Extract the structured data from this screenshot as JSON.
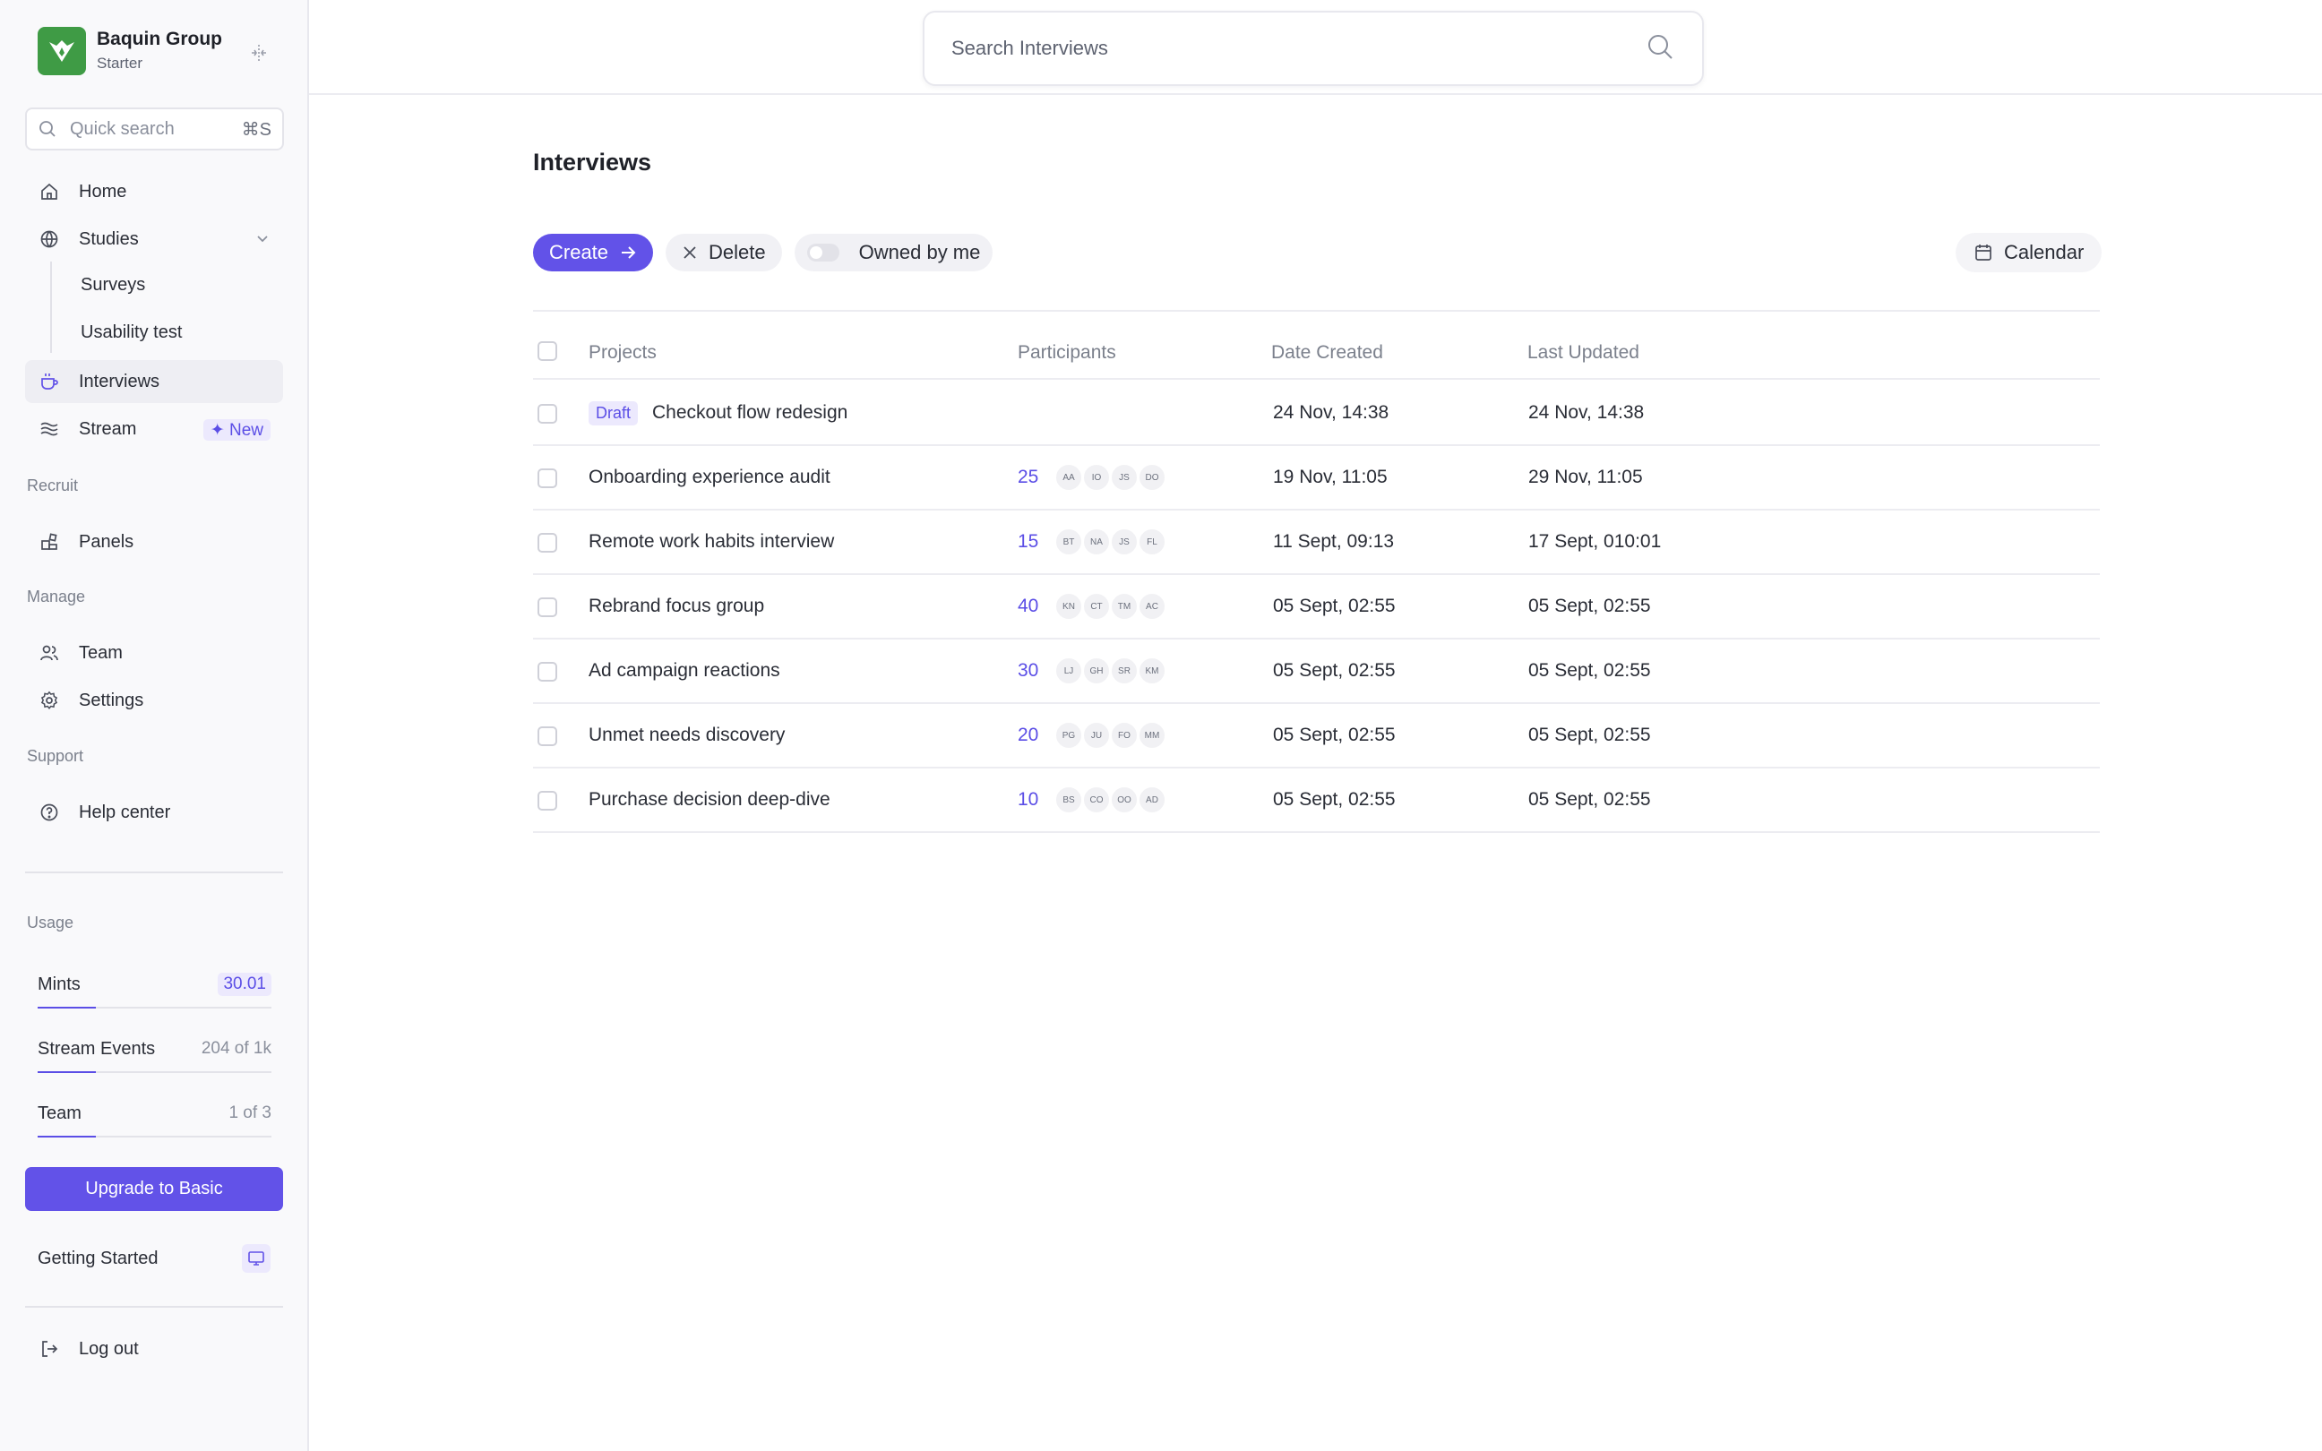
{
  "workspace": {
    "name": "Baquin Group",
    "plan": "Starter",
    "logo_color": "#3f9b45"
  },
  "quick_search": {
    "placeholder": "Quick search",
    "shortcut": "⌘S"
  },
  "nav": {
    "home": "Home",
    "studies": "Studies",
    "surveys": "Surveys",
    "usability_test": "Usability test",
    "interviews": "Interviews",
    "stream": "Stream",
    "stream_badge": "✦ New",
    "recruit_section": "Recruit",
    "panels": "Panels",
    "manage_section": "Manage",
    "team": "Team",
    "settings": "Settings",
    "support_section": "Support",
    "help_center": "Help center"
  },
  "usage": {
    "title": "Usage",
    "items": [
      {
        "label": "Mints",
        "value": "30.01",
        "progress": 0.25
      },
      {
        "label": "Stream Events",
        "value": "204 of 1k",
        "progress": 0.25
      },
      {
        "label": "Team",
        "value": "1 of 3",
        "progress": 0.25
      }
    ]
  },
  "upgrade_label": "Upgrade to Basic",
  "getting_started": "Getting Started",
  "logout": "Log out",
  "search": {
    "placeholder": "Search Interviews"
  },
  "page": {
    "title": "Interviews"
  },
  "toolbar": {
    "create": "Create",
    "delete": "Delete",
    "owned_by_me": "Owned by me",
    "calendar": "Calendar"
  },
  "table": {
    "columns": [
      "Projects",
      "Participants",
      "Date Created",
      "Last Updated"
    ],
    "rows": [
      {
        "badge": "Draft",
        "project": "Checkout flow redesign",
        "count": "",
        "avatars": [],
        "created": "24 Nov, 14:38",
        "updated": "24 Nov, 14:38"
      },
      {
        "badge": "",
        "project": "Onboarding experience audit",
        "count": "25",
        "avatars": [
          "AA",
          "IO",
          "JS",
          "DO"
        ],
        "created": "19 Nov, 11:05",
        "updated": "29 Nov, 11:05"
      },
      {
        "badge": "",
        "project": "Remote work habits interview",
        "count": "15",
        "avatars": [
          "BT",
          "NA",
          "JS",
          "FL"
        ],
        "created": "11 Sept, 09:13",
        "updated": "17 Sept, 010:01"
      },
      {
        "badge": "",
        "project": "Rebrand focus group",
        "count": "40",
        "avatars": [
          "KN",
          "CT",
          "TM",
          "AC"
        ],
        "created": "05 Sept, 02:55",
        "updated": "05 Sept, 02:55"
      },
      {
        "badge": "",
        "project": "Ad campaign reactions",
        "count": "30",
        "avatars": [
          "LJ",
          "GH",
          "SR",
          "KM"
        ],
        "created": "05 Sept, 02:55",
        "updated": "05 Sept, 02:55"
      },
      {
        "badge": "",
        "project": "Unmet needs discovery",
        "count": "20",
        "avatars": [
          "PG",
          "JU",
          "FO",
          "MM"
        ],
        "created": "05 Sept, 02:55",
        "updated": "05 Sept, 02:55"
      },
      {
        "badge": "",
        "project": "Purchase decision deep-dive",
        "count": "10",
        "avatars": [
          "BS",
          "CO",
          "OO",
          "AD"
        ],
        "created": "05 Sept, 02:55",
        "updated": "05 Sept, 02:55"
      }
    ]
  },
  "colors": {
    "accent": "#6252e8",
    "accent_soft": "#ece9fd",
    "brand_green": "#3f9b45"
  }
}
